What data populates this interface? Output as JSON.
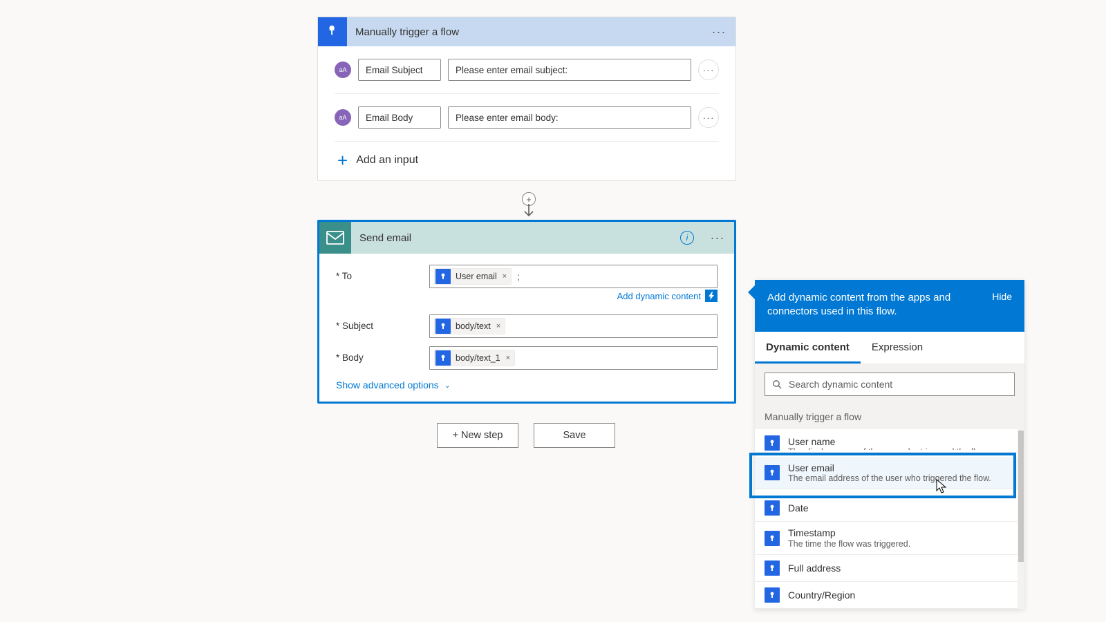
{
  "trigger": {
    "title": "Manually trigger a flow",
    "inputs": [
      {
        "name": "Email Subject",
        "placeholder": "Please enter email subject:"
      },
      {
        "name": "Email Body",
        "placeholder": "Please enter email body:"
      }
    ],
    "add_input_label": "Add an input"
  },
  "action": {
    "title": "Send email",
    "fields": {
      "to_label": "To",
      "to_token": "User email",
      "subject_label": "Subject",
      "subject_token": "body/text",
      "body_label": "Body",
      "body_token": "body/text_1"
    },
    "add_dynamic_content": "Add dynamic content",
    "advanced_options": "Show advanced options"
  },
  "footer": {
    "new_step": "+ New step",
    "save": "Save"
  },
  "dyn_panel": {
    "header_text": "Add dynamic content from the apps and connectors used in this flow.",
    "hide": "Hide",
    "tab_dynamic": "Dynamic content",
    "tab_expression": "Expression",
    "search_placeholder": "Search dynamic content",
    "section_title": "Manually trigger a flow",
    "items": [
      {
        "title": "User name",
        "desc": "The display name of the user who triggered the flow"
      },
      {
        "title": "User email",
        "desc": "The email address of the user who triggered the flow."
      },
      {
        "title": "Date",
        "desc": ""
      },
      {
        "title": "Timestamp",
        "desc": "The time the flow was triggered."
      },
      {
        "title": "Full address",
        "desc": ""
      },
      {
        "title": "Country/Region",
        "desc": ""
      }
    ]
  }
}
